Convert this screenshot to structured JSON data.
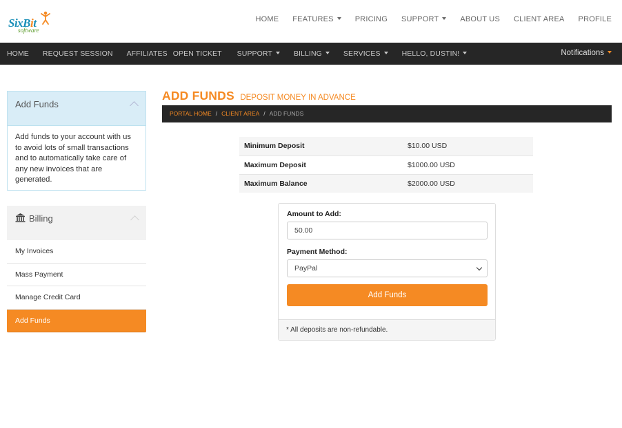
{
  "brand": {
    "name_part1": "SixB",
    "name_part2": "i",
    "name_part3": "t",
    "tagline": "software",
    "accent": "#f58a23",
    "logo_blue": "#1a8fb8",
    "logo_green": "#5a9a2a"
  },
  "top_nav": {
    "home": "HOME",
    "features": "FEATURES",
    "pricing": "PRICING",
    "support": "SUPPORT",
    "about": "ABOUT US",
    "client_area": "CLIENT AREA",
    "profile": "PROFILE"
  },
  "dark_nav": {
    "home": "HOME",
    "request_session": "REQUEST SESSION",
    "affiliates": "AFFILIATES",
    "open_ticket": "OPEN TICKET",
    "support": "SUPPORT",
    "billing": "BILLING",
    "services": "SERVICES",
    "user": "HELLO, DUSTIN!",
    "notifications": "Notifications"
  },
  "sidebar": {
    "info_panel": {
      "title": "Add Funds",
      "body": "Add funds to your account with us to avoid lots of small transactions and to automatically take care of any new invoices that are generated."
    },
    "billing_panel": {
      "title": "Billing",
      "icon": "bank-icon",
      "items": [
        {
          "label": "My Invoices"
        },
        {
          "label": "Mass Payment"
        },
        {
          "label": "Manage Credit Card"
        },
        {
          "label": "Add Funds",
          "active": true
        }
      ]
    }
  },
  "page": {
    "title": "ADD FUNDS",
    "subtitle": "DEPOSIT MONEY IN ADVANCE",
    "breadcrumb": {
      "portal_home": "PORTAL HOME",
      "client_area": "CLIENT AREA",
      "current": "ADD FUNDS"
    }
  },
  "limits": [
    {
      "label": "Minimum Deposit",
      "value": "$10.00 USD"
    },
    {
      "label": "Maximum Deposit",
      "value": "$1000.00 USD"
    },
    {
      "label": "Maximum Balance",
      "value": "$2000.00 USD"
    }
  ],
  "form": {
    "amount_label": "Amount to Add:",
    "amount_value": "50.00",
    "payment_label": "Payment Method:",
    "payment_value": "PayPal",
    "submit_label": "Add Funds",
    "footnote": "* All deposits are non-refundable."
  }
}
